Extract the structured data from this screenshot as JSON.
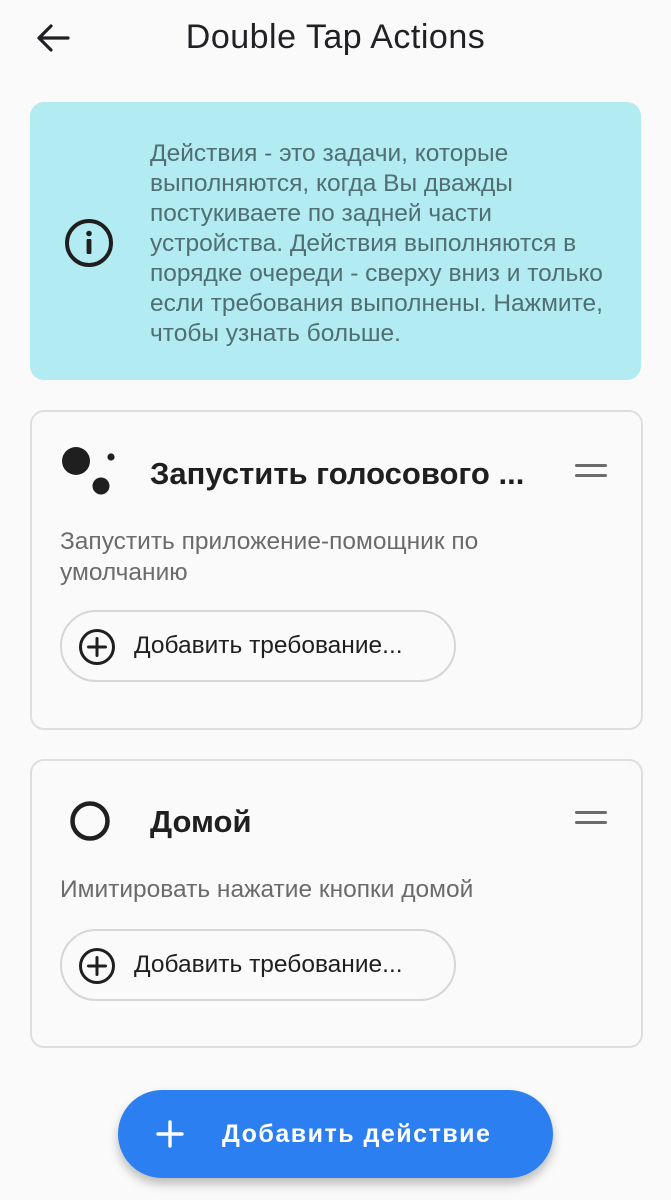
{
  "app_bar": {
    "back_icon": "arrow-left-icon",
    "title": "Double Tap Actions"
  },
  "info_card": {
    "icon": "info-icon",
    "text": "Действия - это задачи, которые выполняются, когда Вы дважды постукиваете по задней части устройства. Действия выполняются в порядке очереди - сверху вниз и только если требования выполнены. Нажмите, чтобы узнать больше.",
    "background": "#b2ebf2"
  },
  "actions": [
    {
      "icon": "google-assistant-icon",
      "title": "Запустить голосового ...",
      "description": "Запустить приложение-помощник по умолчанию",
      "add_requirement_label": "Добавить требование...",
      "drag_icon": "drag-handle-icon"
    },
    {
      "icon": "home-circle-icon",
      "title": "Домой",
      "description": "Имитировать нажатие кнопки домой",
      "add_requirement_label": "Добавить требование...",
      "drag_icon": "drag-handle-icon"
    }
  ],
  "fab": {
    "icon": "plus-icon",
    "label": "Добавить действие",
    "color": "#2b7ff0"
  }
}
